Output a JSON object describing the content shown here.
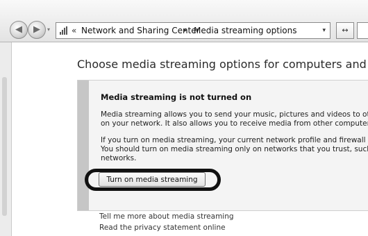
{
  "address_bar": {
    "chevron": "«",
    "crumbs": [
      "Network and Sharing Center",
      "Media streaming options"
    ],
    "separator": "▸",
    "dropdown_glyph": "▾",
    "refresh_glyph": "↔"
  },
  "nav": {
    "back_glyph": "◀",
    "forward_glyph": "▶",
    "history_glyph": "▾"
  },
  "page": {
    "title": "Choose media streaming options for computers and devices"
  },
  "status_panel": {
    "title": "Media streaming is not turned on",
    "paragraph1": [
      "Media streaming allows you to send your music, pictures and videos to other c",
      "on your network.  It also allows you to receive media from other computers an"
    ],
    "paragraph2": [
      "If you turn on media streaming, your current network profile and firewall settin",
      "You should turn on media streaming only on networks that you trust, such as",
      "networks."
    ],
    "button_label": "Turn on media streaming"
  },
  "links": [
    "Tell me more about media streaming",
    "Read the privacy statement online"
  ]
}
